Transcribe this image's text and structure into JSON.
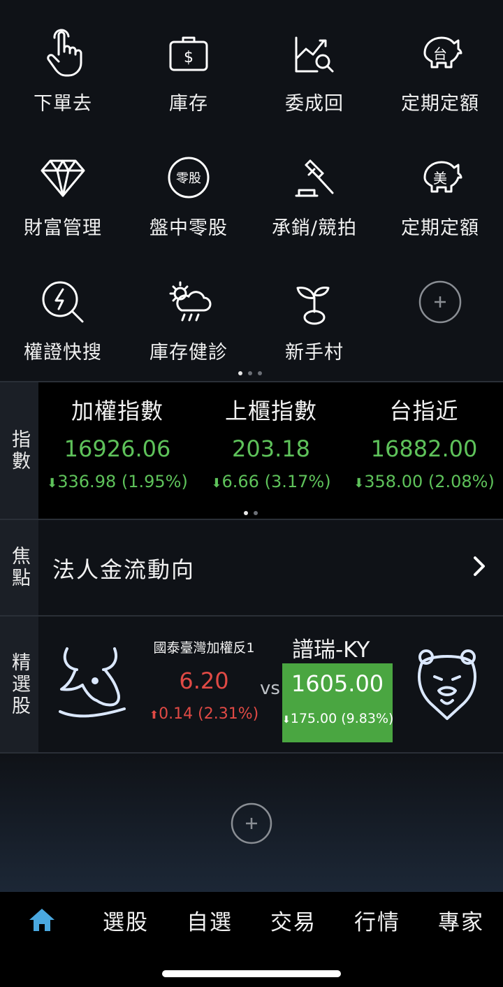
{
  "shortcuts": [
    {
      "label": "下單去",
      "icon": "hand-pointer-icon"
    },
    {
      "label": "庫存",
      "icon": "money-bag-icon"
    },
    {
      "label": "委成回",
      "icon": "chart-search-icon"
    },
    {
      "label": "定期定額",
      "icon": "piggy-bank-icon",
      "badge": "台"
    },
    {
      "label": "財富管理",
      "icon": "diamond-icon"
    },
    {
      "label": "盤中零股",
      "icon": "odd-lot-icon",
      "badge": "零股"
    },
    {
      "label": "承銷/競拍",
      "icon": "gavel-icon"
    },
    {
      "label": "定期定額",
      "icon": "piggy-bank-icon",
      "badge": "美"
    },
    {
      "label": "權證快搜",
      "icon": "lightning-search-icon"
    },
    {
      "label": "庫存健診",
      "icon": "weather-icon"
    },
    {
      "label": "新手村",
      "icon": "sprout-icon"
    }
  ],
  "index_panel": {
    "side_label": "指數",
    "items": [
      {
        "name": "加權指數",
        "value": "16926.06",
        "change": "336.98 (1.95%)"
      },
      {
        "name": "上櫃指數",
        "value": "203.18",
        "change": "6.66 (3.17%)"
      },
      {
        "name": "台指近",
        "value": "16882.00",
        "change": "358.00 (2.08%)"
      }
    ]
  },
  "focus_panel": {
    "side_label": "焦點",
    "title": "法人金流動向"
  },
  "picks_panel": {
    "side_label": "精選股",
    "left": {
      "name": "國泰臺灣加權反1",
      "value": "6.20",
      "change": "0.14 (2.31%)"
    },
    "vs": "vs",
    "right": {
      "name": "譜瑞-KY",
      "value": "1605.00",
      "change": "175.00 (9.83%)"
    }
  },
  "nav": {
    "items": [
      "選股",
      "自選",
      "交易",
      "行情",
      "專家"
    ]
  },
  "colors": {
    "up": "#e04a45",
    "down": "#5ec25a",
    "accent": "#4aa8e0"
  }
}
